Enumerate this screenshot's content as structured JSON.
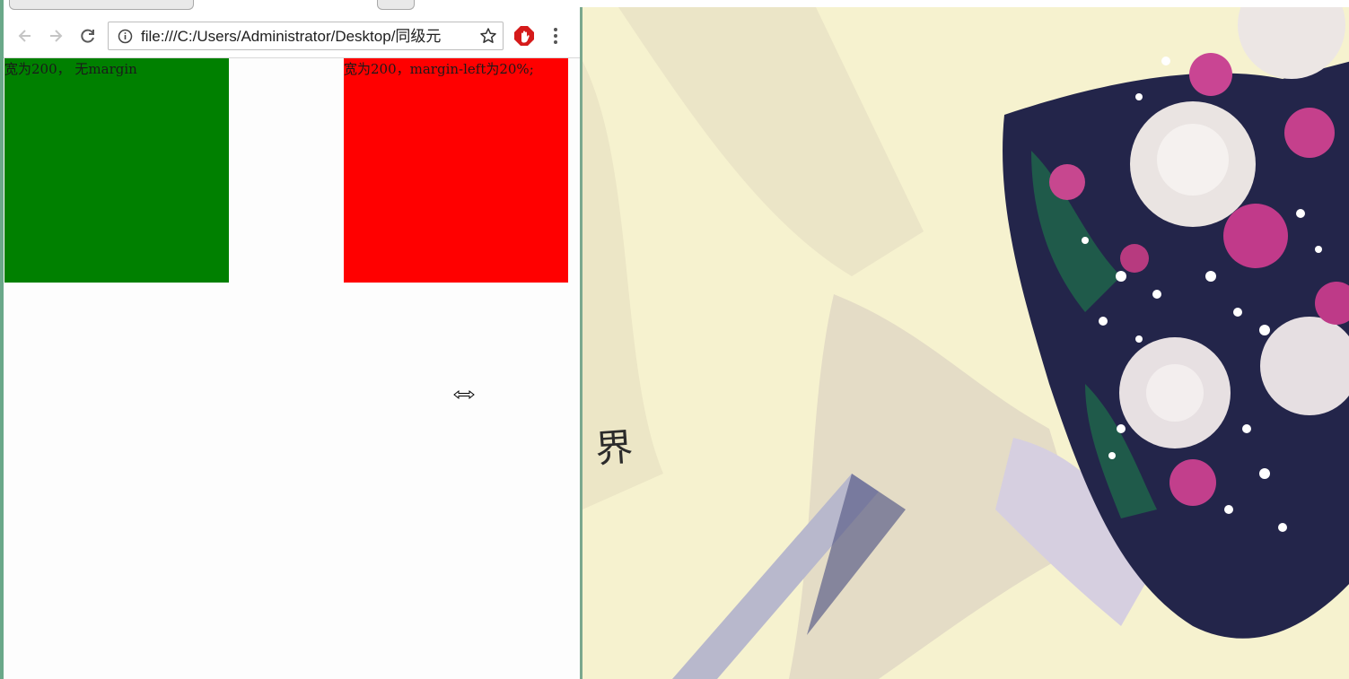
{
  "browser": {
    "address_url": "file:///C:/Users/Administrator/Desktop/同级元",
    "icons": {
      "back": "back-arrow-icon",
      "forward": "forward-arrow-icon",
      "reload": "reload-icon",
      "info": "info-icon",
      "bookmark": "star-icon",
      "extension": "adblock-icon",
      "menu": "kebab-menu-icon"
    }
  },
  "page": {
    "green_box_text": "宽为200， 无margin",
    "red_box_text": "宽为200，margin-left为20%;",
    "green_box_color": "#008000",
    "red_box_color": "#ff0000"
  },
  "cursor": {
    "icon": "horizontal-resize-cursor-icon"
  },
  "photo": {
    "caption": "界",
    "background_color": "#f6f2cf"
  }
}
